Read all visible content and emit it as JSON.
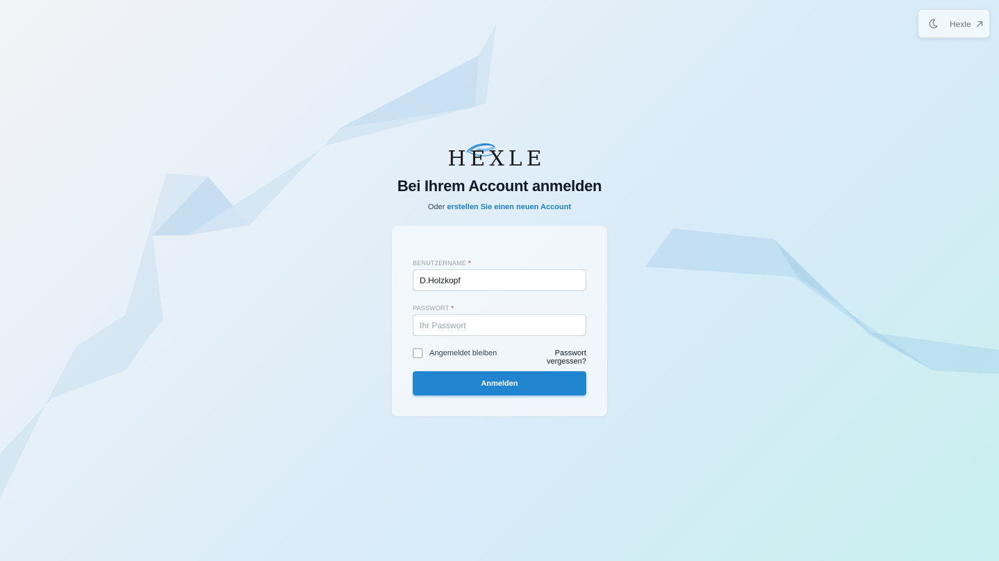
{
  "colors": {
    "accent": "#2185d0",
    "link": "#1f7fc9",
    "required": "#dc2626",
    "title": "#111827"
  },
  "top_widget": {
    "theme_icon": "moon-icon",
    "link_label": "Hexle",
    "link_icon": "arrow-up-right-icon"
  },
  "logo": {
    "text": "HEXLE"
  },
  "header": {
    "title": "Bei Ihrem Account anmelden",
    "subline_prefix": "Oder",
    "subline_link": "erstellen Sie einen neuen Account"
  },
  "form": {
    "username_label": "BENUTZERNAME",
    "username_value": "D.Holzkopf",
    "password_label": "PASSWORT",
    "password_placeholder": "Ihr Passwort",
    "required_mark": "*",
    "remember_label": "Angemeldet bleiben",
    "forgot_label": "Passwort vergessen?",
    "submit_label": "Anmelden"
  }
}
